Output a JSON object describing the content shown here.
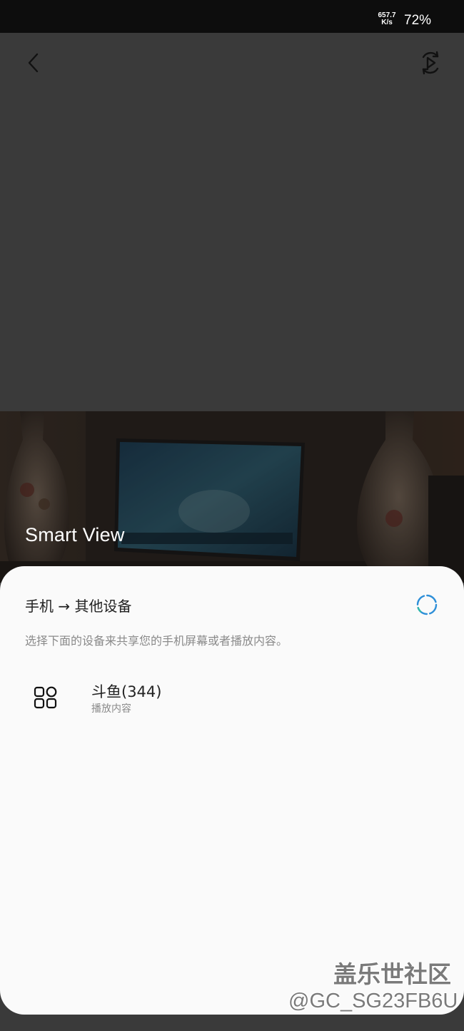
{
  "status_bar": {
    "net_speed_value": "657.7",
    "net_speed_unit": "K/s",
    "battery": "72%"
  },
  "toolbar": {
    "back_icon": "chevron-left-icon",
    "mirror_icon": "screen-mirror-play-icon"
  },
  "hero": {
    "title": "Smart View"
  },
  "sheet": {
    "heading": "手机 → 其他设备",
    "description": "选择下面的设备来共享您的手机屏幕或者播放内容。",
    "loading_icon": "loading-spinner-icon",
    "devices": [
      {
        "name": "斗鱼(344)",
        "subtitle": "播放内容",
        "icon": "apps-grid-icon"
      }
    ]
  },
  "watermark": {
    "logo": "盖乐世社区",
    "user": "@GC_SG23FB6U"
  },
  "colors": {
    "status_bar_bg": "#0d0d0d",
    "dimmed_bg": "#3a3a3a",
    "sheet_bg": "#fafafa",
    "spinner_accent": "#2e8fd8"
  }
}
